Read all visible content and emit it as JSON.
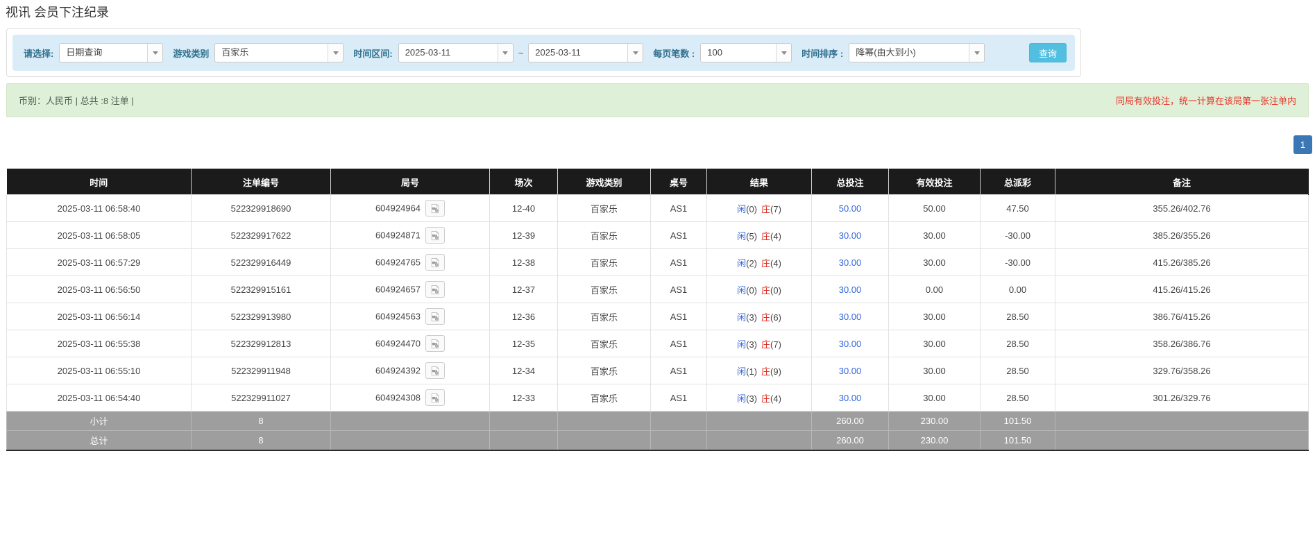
{
  "page": {
    "title": "视讯 会员下注纪录"
  },
  "filters": {
    "select_label": "请选择:",
    "select_value": "日期查询",
    "game_type_label": "游戏类别",
    "game_type_value": "百家乐",
    "time_range_label": "时间区间:",
    "date_from": "2025-03-11",
    "tilde": "~",
    "date_to": "2025-03-11",
    "page_size_label": "每页笔数 :",
    "page_size_value": "100",
    "sort_label": "时间排序 :",
    "sort_value": "降幂(由大到小)",
    "search_button": "查询"
  },
  "summary": {
    "left": "币别：人民币 | 总共 :8 注单 |",
    "notice": "同局有效投注，统一计算在该局第一张注单内"
  },
  "pagination": {
    "current": "1"
  },
  "table": {
    "headers": [
      "时间",
      "注单编号",
      "局号",
      "场次",
      "游戏类别",
      "桌号",
      "结果",
      "总投注",
      "有效投注",
      "总派彩",
      "备注"
    ],
    "result_labels": {
      "player": "闲",
      "banker": "庄"
    },
    "rows": [
      {
        "time": "2025-03-11 06:58:40",
        "bet_id": "522329918690",
        "round_id": "604924964",
        "session": "12-40",
        "game": "百家乐",
        "table_no": "AS1",
        "result_player": "(0)",
        "result_banker": "(7)",
        "total_bet": "50.00",
        "valid_bet": "50.00",
        "payout": "47.50",
        "remark": "355.26/402.76"
      },
      {
        "time": "2025-03-11 06:58:05",
        "bet_id": "522329917622",
        "round_id": "604924871",
        "session": "12-39",
        "game": "百家乐",
        "table_no": "AS1",
        "result_player": "(5)",
        "result_banker": "(4)",
        "total_bet": "30.00",
        "valid_bet": "30.00",
        "payout": "-30.00",
        "remark": "385.26/355.26"
      },
      {
        "time": "2025-03-11 06:57:29",
        "bet_id": "522329916449",
        "round_id": "604924765",
        "session": "12-38",
        "game": "百家乐",
        "table_no": "AS1",
        "result_player": "(2)",
        "result_banker": "(4)",
        "total_bet": "30.00",
        "valid_bet": "30.00",
        "payout": "-30.00",
        "remark": "415.26/385.26"
      },
      {
        "time": "2025-03-11 06:56:50",
        "bet_id": "522329915161",
        "round_id": "604924657",
        "session": "12-37",
        "game": "百家乐",
        "table_no": "AS1",
        "result_player": "(0)",
        "result_banker": "(0)",
        "total_bet": "30.00",
        "valid_bet": "0.00",
        "payout": "0.00",
        "remark": "415.26/415.26"
      },
      {
        "time": "2025-03-11 06:56:14",
        "bet_id": "522329913980",
        "round_id": "604924563",
        "session": "12-36",
        "game": "百家乐",
        "table_no": "AS1",
        "result_player": "(3)",
        "result_banker": "(6)",
        "total_bet": "30.00",
        "valid_bet": "30.00",
        "payout": "28.50",
        "remark": "386.76/415.26"
      },
      {
        "time": "2025-03-11 06:55:38",
        "bet_id": "522329912813",
        "round_id": "604924470",
        "session": "12-35",
        "game": "百家乐",
        "table_no": "AS1",
        "result_player": "(3)",
        "result_banker": "(7)",
        "total_bet": "30.00",
        "valid_bet": "30.00",
        "payout": "28.50",
        "remark": "358.26/386.76"
      },
      {
        "time": "2025-03-11 06:55:10",
        "bet_id": "522329911948",
        "round_id": "604924392",
        "session": "12-34",
        "game": "百家乐",
        "table_no": "AS1",
        "result_player": "(1)",
        "result_banker": "(9)",
        "total_bet": "30.00",
        "valid_bet": "30.00",
        "payout": "28.50",
        "remark": "329.76/358.26"
      },
      {
        "time": "2025-03-11 06:54:40",
        "bet_id": "522329911027",
        "round_id": "604924308",
        "session": "12-33",
        "game": "百家乐",
        "table_no": "AS1",
        "result_player": "(3)",
        "result_banker": "(4)",
        "total_bet": "30.00",
        "valid_bet": "30.00",
        "payout": "28.50",
        "remark": "301.26/329.76"
      }
    ],
    "subtotal": {
      "label": "小计",
      "count": "8",
      "total_bet": "260.00",
      "valid_bet": "230.00",
      "payout": "101.50"
    },
    "total": {
      "label": "总计",
      "count": "8",
      "total_bet": "260.00",
      "valid_bet": "230.00",
      "payout": "101.50"
    }
  },
  "colors": {
    "label_blue": "#31708f",
    "button_cyan": "#52bfe0",
    "button_border": "#46b8da",
    "filter_bg": "#d9ecf7",
    "alert_bg": "#dff0d8",
    "alert_text": "#4f5d4f",
    "notice_red": "#e8352a",
    "page_btn_blue": "#3a78b5",
    "header_bg": "#1b1b1b",
    "subtotal_bg": "#9e9e9e",
    "link_blue": "#3366dd",
    "player_blue": "#2f62d9",
    "banker_red": "#e02b20",
    "negative_red": "#e02b20"
  }
}
